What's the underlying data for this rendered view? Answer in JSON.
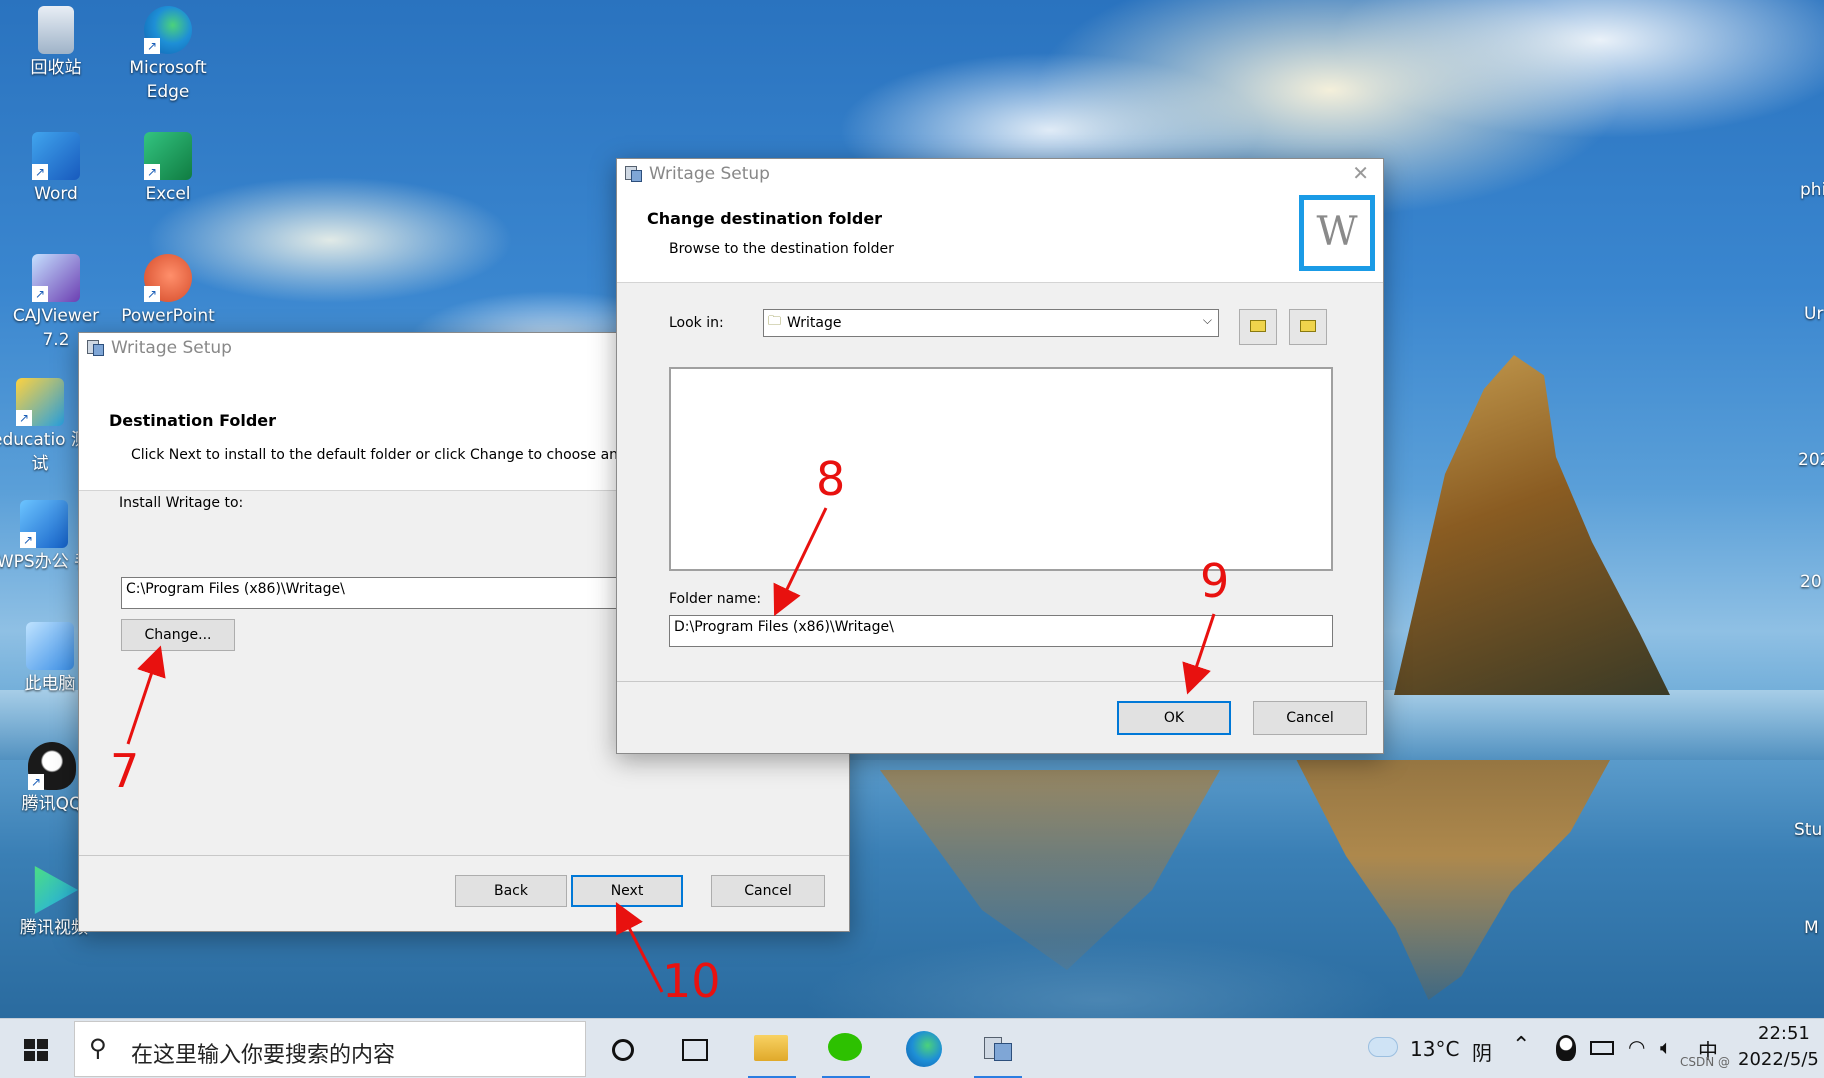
{
  "desktop": {
    "icons": [
      {
        "label": "回收站",
        "icon": "recycle-bin-icon"
      },
      {
        "label": "Microsoft Edge",
        "icon": "edge-icon"
      },
      {
        "label": "Word",
        "icon": "word-icon"
      },
      {
        "label": "Excel",
        "icon": "excel-icon"
      },
      {
        "label": "CAJViewer 7.2",
        "icon": "cajviewer-icon"
      },
      {
        "label": "PowerPoint",
        "icon": "powerpoint-icon"
      },
      {
        "label": "educatio 测试",
        "icon": "education-icon"
      },
      {
        "label": "WPS办公 手",
        "icon": "wps-icon"
      },
      {
        "label": "此电脑",
        "icon": "this-pc-icon"
      },
      {
        "label": "腾讯QQ",
        "icon": "qq-icon"
      },
      {
        "label": "腾讯视频",
        "icon": "tencent-video-icon"
      }
    ],
    "right_edge": [
      "phi",
      "Ur",
      "202",
      "20",
      "Stu",
      "M"
    ]
  },
  "dialog_back": {
    "title": "Writage Setup",
    "heading": "Destination Folder",
    "subheading": "Click Next to install to the default folder or click Change to choose an",
    "install_label": "Install Writage to:",
    "install_path": "C:\\Program Files (x86)\\Writage\\",
    "change_button": "Change...",
    "back_button": "Back",
    "next_button": "Next",
    "cancel_button": "Cancel"
  },
  "dialog_front": {
    "title": "Writage Setup",
    "heading": "Change destination folder",
    "subheading": "Browse to the destination folder",
    "logo_letter": "W",
    "lookin_label": "Look in:",
    "lookin_value": "Writage",
    "folder_name_label": "Folder name:",
    "folder_name_value": "D:\\Program Files (x86)\\Writage\\",
    "ok_button": "OK",
    "cancel_button": "Cancel",
    "close_glyph": "✕"
  },
  "annotations": [
    "7",
    "8",
    "9",
    "10"
  ],
  "taskbar": {
    "search_placeholder": "在这里输入你要搜索的内容",
    "weather_temp": "13°C",
    "weather_desc": "阴",
    "ime": "中",
    "time": "22:51",
    "date": "2022/5/5",
    "watermark": "CSDN @"
  },
  "colors": {
    "accent": "#0078d7",
    "annotation": "#e8110f",
    "dialog_bg": "#f0f0f0",
    "taskbar_bg": "#dfe6ee"
  }
}
